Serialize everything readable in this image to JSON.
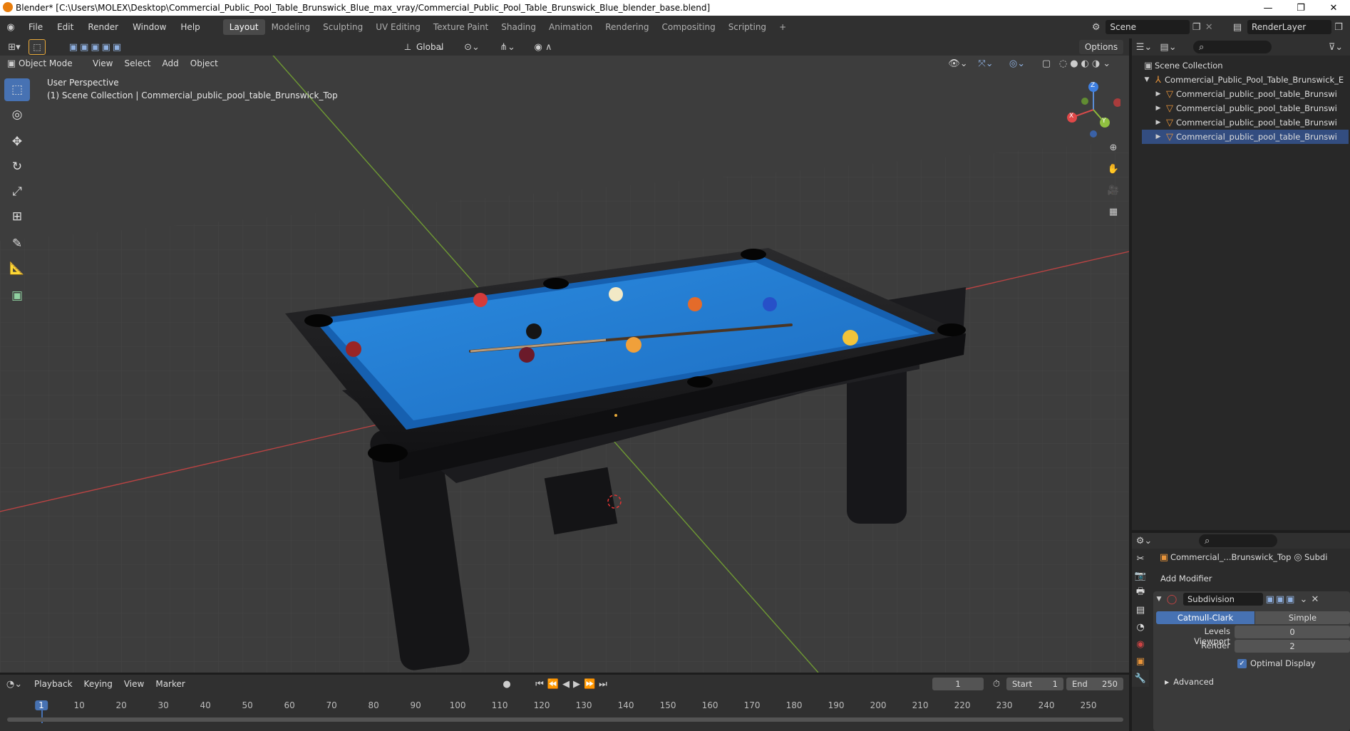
{
  "window": {
    "title": "Blender* [C:\\Users\\MOLEX\\Desktop\\Commercial_Public_Pool_Table_Brunswick_Blue_max_vray/Commercial_Public_Pool_Table_Brunswick_Blue_blender_base.blend]",
    "minimize": "—",
    "restore": "❐",
    "close": "✕"
  },
  "menu": [
    "File",
    "Edit",
    "Render",
    "Window",
    "Help"
  ],
  "workspaces": [
    "Layout",
    "Modeling",
    "Sculpting",
    "UV Editing",
    "Texture Paint",
    "Shading",
    "Animation",
    "Rendering",
    "Compositing",
    "Scripting"
  ],
  "workspace_add": "+",
  "scene": {
    "name": "Scene",
    "render_layer": "RenderLayer"
  },
  "viewport_header": {
    "mode": "Object Mode",
    "menus": [
      "View",
      "Select",
      "Add",
      "Object"
    ],
    "orientation": "Global",
    "options": "Options"
  },
  "viewport": {
    "perspective": "User Perspective",
    "collection_info": "(1) Scene Collection | Commercial_public_pool_table_Brunswick_Top",
    "gizmo": {
      "x": "X",
      "y": "Y",
      "z": "Z"
    },
    "colors": {
      "felt": "#1f7fd4",
      "background": "#3d3d3d",
      "x_axis": "#c84a4a",
      "y_axis": "#7aa63a"
    }
  },
  "outliner": {
    "root": "Scene Collection",
    "collection": "Commercial_Public_Pool_Table_Brunswick_E",
    "objects": [
      "Commercial_public_pool_table_Brunswi",
      "Commercial_public_pool_table_Brunswi",
      "Commercial_public_pool_table_Brunswi",
      "Commercial_public_pool_table_Brunswi"
    ]
  },
  "properties": {
    "object_name": "Commercial_...Brunswick_Top",
    "modifier_short": "Subdi",
    "add_modifier": "Add Modifier",
    "modifier_name": "Subdivision",
    "algo_options": [
      "Catmull-Clark",
      "Simple"
    ],
    "levels_viewport_label": "Levels Viewport",
    "levels_viewport": "0",
    "render_label": "Render",
    "render_levels": "2",
    "optimal_display": "Optimal Display",
    "advanced": "Advanced"
  },
  "timeline": {
    "menus": [
      "Playback",
      "Keying",
      "View",
      "Marker"
    ],
    "current_frame": "1",
    "start_label": "Start",
    "start": "1",
    "end_label": "End",
    "end": "250",
    "ticks": [
      "1",
      "10",
      "20",
      "30",
      "40",
      "50",
      "60",
      "70",
      "80",
      "90",
      "100",
      "110",
      "120",
      "130",
      "140",
      "150",
      "160",
      "170",
      "180",
      "190",
      "200",
      "210",
      "220",
      "230",
      "240",
      "250"
    ]
  }
}
